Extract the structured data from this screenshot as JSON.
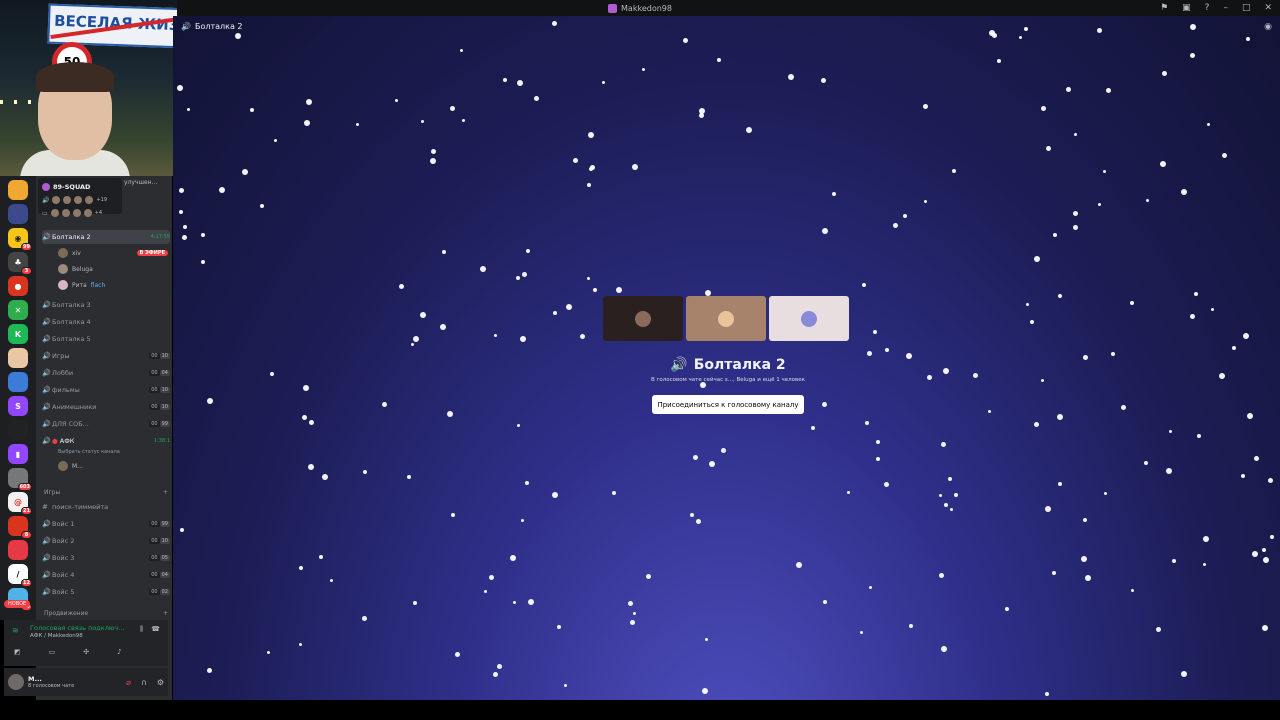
{
  "titlebar": {
    "title": "Makkedon98",
    "icons": [
      "inbox-icon",
      "screen-icon",
      "help-icon",
      "minimize-icon",
      "maximize-icon",
      "close-icon"
    ]
  },
  "webcam": {
    "sign_text": "ВЕСЕЛАЯ ЖИЗ",
    "speed_limit": "50"
  },
  "server": {
    "name": "89-SQUAD",
    "more_top": "+19",
    "more_bottom": "+4",
    "subtitle": "улучшен..."
  },
  "channels": {
    "voice": [
      {
        "name": "Болталка 2",
        "time": "4:17:55",
        "active": true
      },
      {
        "name": "Болталка 3"
      },
      {
        "name": "Болталка 4"
      },
      {
        "name": "Болталка 5"
      },
      {
        "name": "Игры",
        "c1": "00",
        "c2": "10"
      },
      {
        "name": "Лобби",
        "c1": "00",
        "c2": "04"
      },
      {
        "name": "фильмы",
        "c1": "00",
        "c2": "10"
      },
      {
        "name": "Анимешники",
        "c1": "00",
        "c2": "10"
      },
      {
        "name": "ДЛЯ СОБ...",
        "c1": "00",
        "c2": "99"
      }
    ],
    "members": [
      {
        "name": "xiv",
        "live": "В ЭФИРЕ"
      },
      {
        "name": "Beluga"
      },
      {
        "name": "Рита",
        "tag": "flach"
      }
    ],
    "afk": {
      "name": "АФК",
      "time": "1:38:1",
      "status_prompt": "Выбрать статус канала",
      "member": "M..."
    },
    "games_category": "Игры",
    "text_channel": "поиск-тиммейта",
    "game_voice": [
      {
        "name": "Войс 1",
        "c1": "00",
        "c2": "99"
      },
      {
        "name": "Войс 2",
        "c1": "00",
        "c2": "10"
      },
      {
        "name": "Войс 3",
        "c1": "00",
        "c2": "05"
      },
      {
        "name": "Войс 4",
        "c1": "00",
        "c2": "04"
      },
      {
        "name": "Войс 5",
        "c1": "00",
        "c2": "02"
      }
    ],
    "next_category": "Продвижение"
  },
  "rail": {
    "badges": [
      "99",
      "3",
      "21",
      "603",
      "8",
      "12",
      "69"
    ],
    "new_label": "НОВОЕ"
  },
  "voice_panel": {
    "title": "Голосовая связь подключ...",
    "subtitle": "АФК / Makkedon98"
  },
  "user_panel": {
    "name": "M...",
    "status": "В голосовом чате"
  },
  "main": {
    "breadcrumb": "Болталка 2",
    "channel_name": "Болталка 2",
    "description": "В голосовом чате сейчас s..., Beluga и ещё 1 человек",
    "join_button": "Присоединиться к голосовому каналу"
  },
  "colors": {
    "accent_green": "#23a55a",
    "danger": "#f23f43",
    "bg_sidebar": "#2b2d31"
  }
}
